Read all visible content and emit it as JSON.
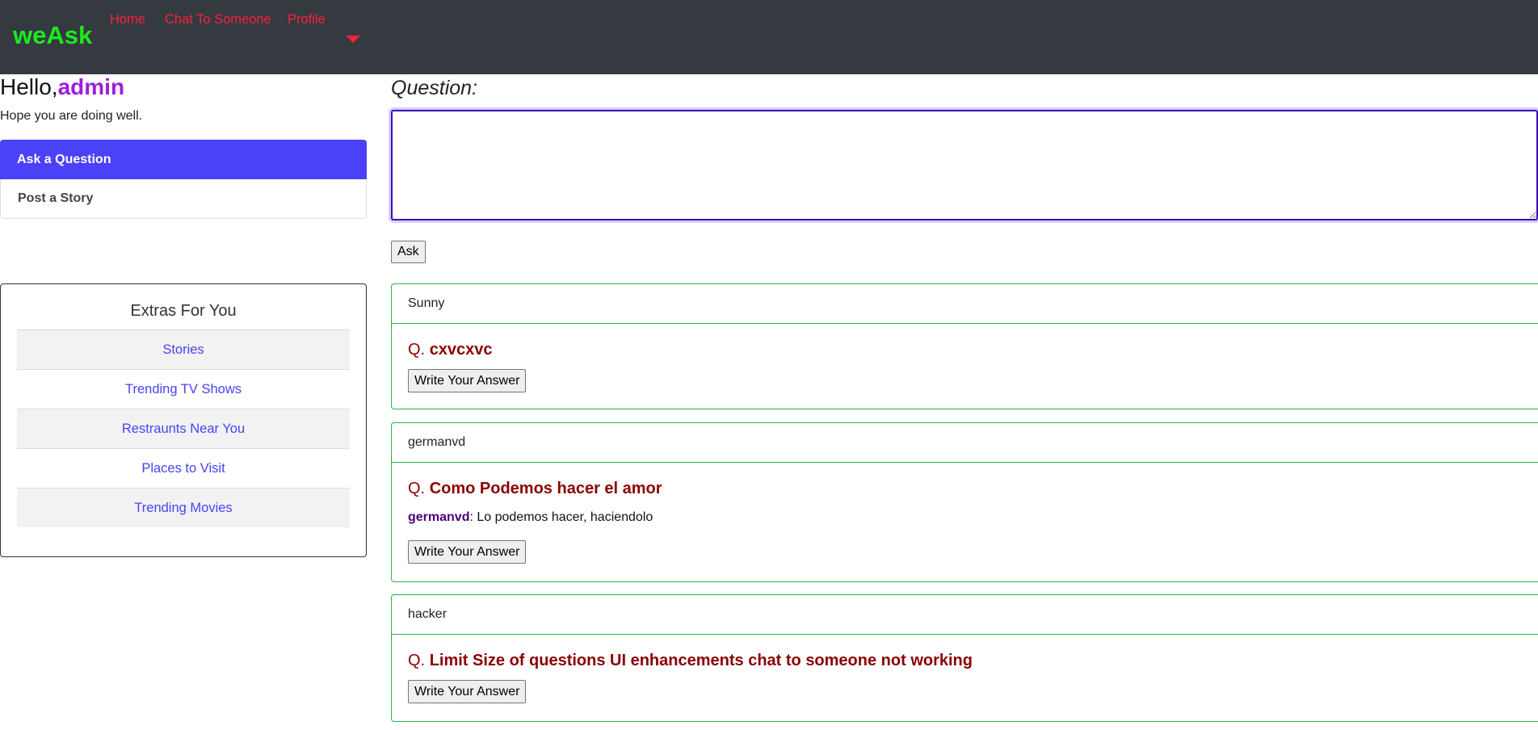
{
  "nav": {
    "brand": "weAsk",
    "links": [
      "Home",
      "Chat To Someone",
      "Profile"
    ]
  },
  "greeting": {
    "hello": "Hello,",
    "username": "admin",
    "subtitle": "Hope you are doing well."
  },
  "sidebar": {
    "buttons": [
      "Ask a Question",
      "Post a Story"
    ]
  },
  "extras": {
    "title": "Extras For You",
    "items": [
      "Stories",
      "Trending TV Shows",
      "Restraunts Near You",
      "Places to Visit",
      "Trending Movies"
    ]
  },
  "question_form": {
    "label": "Question:",
    "value": "",
    "submit_label": "Ask"
  },
  "feed": [
    {
      "author": "Sunny",
      "q_prefix": "Q.",
      "question": "cxvcxvc",
      "answers": [],
      "button_label": "Write Your Answer"
    },
    {
      "author": "germanvd",
      "q_prefix": "Q.",
      "question": "Como Podemos hacer el amor",
      "answers": [
        {
          "user": "germanvd",
          "separator": ":",
          "text": " Lo podemos hacer, haciendolo"
        }
      ],
      "button_label": "Write Your Answer"
    },
    {
      "author": "hacker",
      "q_prefix": "Q.",
      "question": "Limit Size of questions UI enhancements chat to someone not working",
      "answers": [],
      "button_label": "Write Your Answer"
    }
  ],
  "colors": {
    "navbar_bg": "#343a40",
    "brand": "#1ee81e",
    "nav_link": "#ff1f3d",
    "accent": "#4942f7",
    "username": "#9d1ddd",
    "question_text": "#8b0000",
    "card_border": "#28b44a"
  }
}
